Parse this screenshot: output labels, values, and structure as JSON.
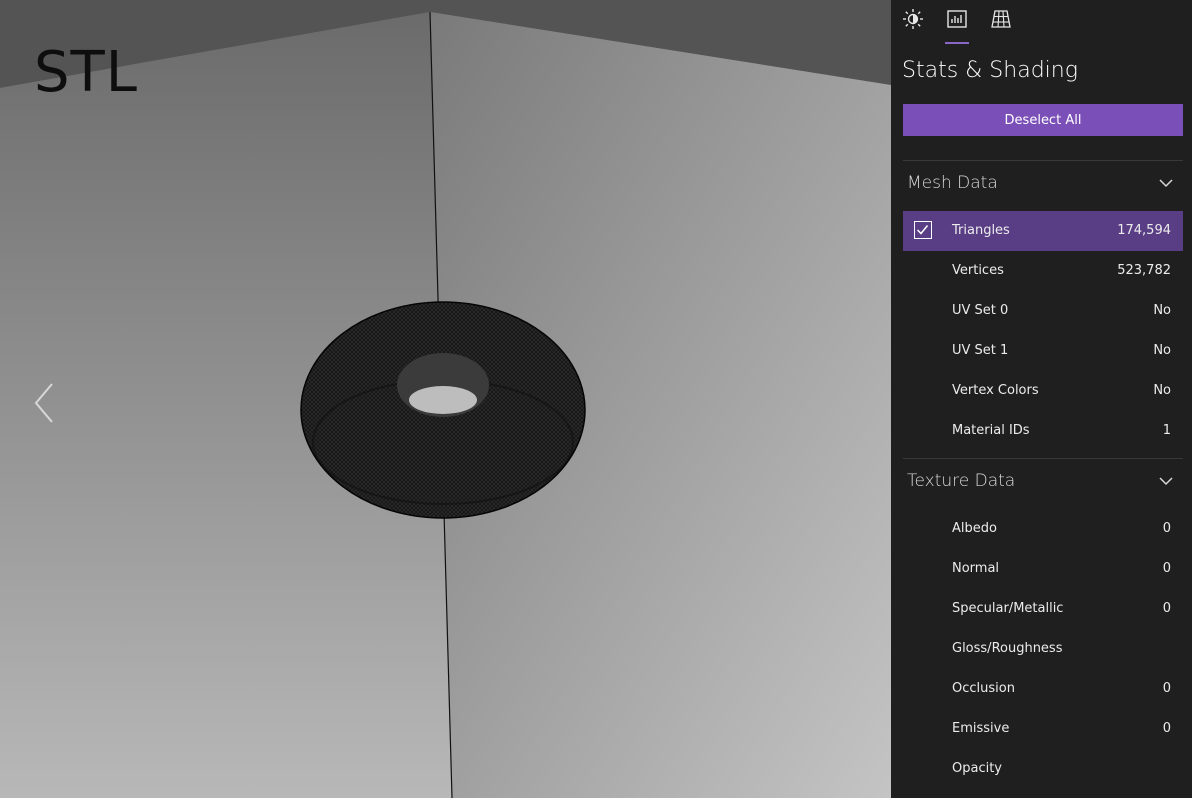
{
  "viewport": {
    "title": "STL",
    "prev_icon": "chevron-left-icon"
  },
  "panel": {
    "tabs": [
      {
        "icon": "sun-icon",
        "active": false
      },
      {
        "icon": "stats-icon",
        "active": true
      },
      {
        "icon": "grid-icon",
        "active": false
      }
    ],
    "title": "Stats & Shading",
    "deselect_label": "Deselect All",
    "accent": "#7b4fb8",
    "mesh": {
      "header": "Mesh Data",
      "rows": [
        {
          "name": "Triangles",
          "value": "174,594",
          "checked": true
        },
        {
          "name": "Vertices",
          "value": "523,782"
        },
        {
          "name": "UV Set 0",
          "value": "No"
        },
        {
          "name": "UV Set 1",
          "value": "No"
        },
        {
          "name": "Vertex Colors",
          "value": "No"
        },
        {
          "name": "Material IDs",
          "value": "1"
        }
      ]
    },
    "texture": {
      "header": "Texture Data",
      "rows": [
        {
          "name": "Albedo",
          "value": "0"
        },
        {
          "name": "Normal",
          "value": "0"
        },
        {
          "name": "Specular/Metallic",
          "value": "0"
        },
        {
          "name": "Gloss/Roughness",
          "value": ""
        },
        {
          "name": "Occlusion",
          "value": "0"
        },
        {
          "name": "Emissive",
          "value": "0"
        },
        {
          "name": "Opacity",
          "value": ""
        }
      ]
    }
  }
}
